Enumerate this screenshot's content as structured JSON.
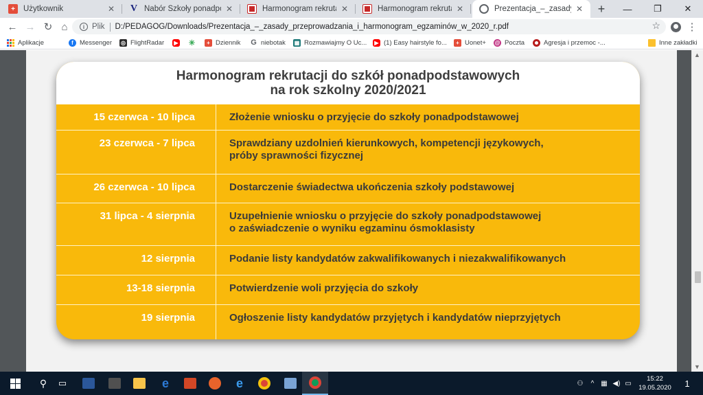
{
  "tabs": [
    {
      "title": "Użytkownik",
      "icon": "red-plus-icon"
    },
    {
      "title": "Nabór Szkoły ponadpodstawowe",
      "icon": "v-logo-icon"
    },
    {
      "title": "Harmonogram rekrutacji do sz",
      "icon": "gov-emblem-icon"
    },
    {
      "title": "Harmonogram rekrutacji do sz",
      "icon": "gov-emblem-icon"
    },
    {
      "title": "Prezentacja_–_zasady_przeprowa",
      "icon": "globe-icon",
      "active": true
    }
  ],
  "omnibox": {
    "scheme": "Plik",
    "url": "D:/PEDAGOG/Downloads/Prezentacja_–_zasady_przeprowadzania_i_harmonogram_egzaminów_w_2020_r.pdf"
  },
  "bookmarks": [
    {
      "label": "Aplikacje",
      "icon": "apps-grid-icon"
    },
    {
      "label": "Messenger",
      "icon": "facebook-icon"
    },
    {
      "label": "FlightRadar",
      "icon": "flightradar-icon"
    },
    {
      "label": "",
      "icon": "youtube-icon"
    },
    {
      "label": "",
      "icon": "loading-icon"
    },
    {
      "label": "Dziennik",
      "icon": "red-plus-icon"
    },
    {
      "label": "niebotak",
      "icon": "google-g-icon"
    },
    {
      "label": "Rozmawiajmy O Uc...",
      "icon": "teal-site-icon"
    },
    {
      "label": "(1) Easy hairstyle fo...",
      "icon": "youtube-icon"
    },
    {
      "label": "Uonet+",
      "icon": "red-plus-icon"
    },
    {
      "label": "Poczta",
      "icon": "poczta-icon"
    },
    {
      "label": "Agresja i przemoc -...",
      "icon": "record-icon"
    },
    {
      "label": "Inne zakładki",
      "icon": "folder-icon"
    }
  ],
  "schedule": {
    "title_line1": "Harmonogram rekrutacji do szkół ponadpodstawowych",
    "title_line2": "na rok szkolny 2020/2021",
    "rows": [
      {
        "date": "15 czerwca - 10 lipca",
        "line1": "Złożenie wniosku o przyjęcie do szkoły ponadpodstawowej",
        "line2": ""
      },
      {
        "date": "23 czerwca - 7 lipca",
        "line1": "Sprawdziany uzdolnień kierunkowych, kompetencji językowych,",
        "line2": "próby sprawności fizycznej"
      },
      {
        "date": "26 czerwca - 10 lipca",
        "line1": "Dostarczenie świadectwa ukończenia szkoły podstawowej",
        "line2": ""
      },
      {
        "date": "31 lipca - 4 sierpnia",
        "line1": "Uzupełnienie wniosku o przyjęcie do szkoły ponadpodstawowej",
        "line2": "o zaświadczenie o wyniku egzaminu ósmoklasisty"
      },
      {
        "date": "12 sierpnia",
        "line1": "Podanie listy kandydatów zakwalifikowanych i niezakwalifikowanych",
        "line2": ""
      },
      {
        "date": "13-18 sierpnia",
        "line1": "Potwierdzenie woli przyjęcia do szkoły",
        "line2": ""
      },
      {
        "date": "19 sierpnia",
        "line1": "Ogłoszenie listy kandydatów przyjętych i kandydatów nieprzyjętych",
        "line2": ""
      }
    ]
  },
  "colors": {
    "accent_yellow": "#f9b90b",
    "date_text": "#ffffff",
    "desc_text": "#3a3a3a",
    "taskbar": "#0b1a2b"
  },
  "taskbar": {
    "time": "15:22",
    "date": "19.05.2020",
    "notification_count": "1"
  }
}
